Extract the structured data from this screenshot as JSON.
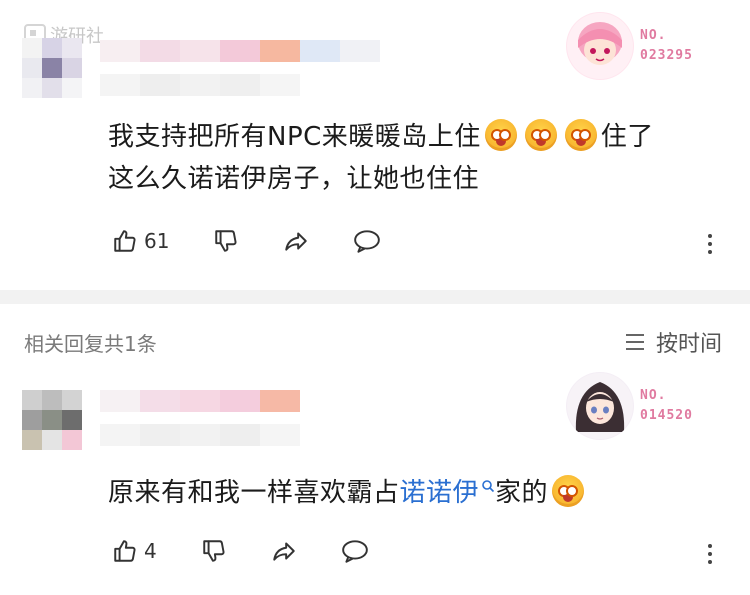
{
  "watermark": {
    "text": "游研社"
  },
  "comment1": {
    "text_a": "我支持把所有NPC来暖暖岛上住",
    "text_b": "住了",
    "text_c": "这么久诺诺伊房子，让她也住住",
    "badge_no": "NO.",
    "badge_num": "023295",
    "like_count": "61"
  },
  "replies_header": {
    "title": "相关回复共1条",
    "sort_label": "按时间"
  },
  "comment2": {
    "text_a": "原来有和我一样喜欢霸占",
    "link_text": "诺诺伊",
    "text_b": "家的",
    "badge_no": "NO.",
    "badge_num": "014520",
    "like_count": "4"
  },
  "icons": [
    "like-icon",
    "dislike-icon",
    "share-icon",
    "reply-icon",
    "more-icon",
    "sort-icon",
    "search-icon"
  ],
  "colors": {
    "link": "#2a6fd1",
    "badge_pink": "#e07aa0",
    "divider": "#f2f2f2"
  }
}
